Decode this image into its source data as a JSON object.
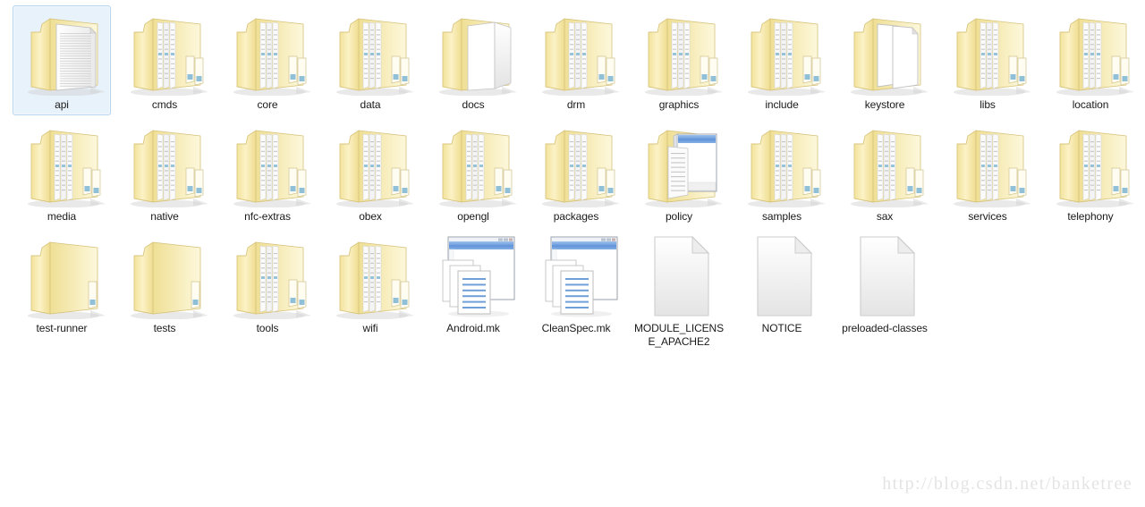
{
  "view": {
    "background": "#ffffff",
    "selection_fill": "#e8f2fb",
    "selection_border": "#b8d6ef",
    "folder_color": "#f7e9a8",
    "folder_color_light": "#fdf6d2",
    "folder_shadow": "#d9d9d9"
  },
  "watermark": {
    "text": "http://blog.csdn.net/banketree",
    "color": "#e4e4e4"
  },
  "items": [
    {
      "label": "api",
      "icon": "folder-open-doc-icon",
      "selected": true,
      "col": 0,
      "row": 0
    },
    {
      "label": "cmds",
      "icon": "folder-stack-icon",
      "selected": false,
      "col": 1,
      "row": 0
    },
    {
      "label": "core",
      "icon": "folder-stack-icon",
      "selected": false,
      "col": 2,
      "row": 0
    },
    {
      "label": "data",
      "icon": "folder-stack-icon",
      "selected": false,
      "col": 3,
      "row": 0
    },
    {
      "label": "docs",
      "icon": "folder-pages-icon",
      "selected": false,
      "col": 4,
      "row": 0
    },
    {
      "label": "drm",
      "icon": "folder-stack-icon",
      "selected": false,
      "col": 5,
      "row": 0
    },
    {
      "label": "graphics",
      "icon": "folder-stack-icon",
      "selected": false,
      "col": 6,
      "row": 0
    },
    {
      "label": "include",
      "icon": "folder-stack-icon",
      "selected": false,
      "col": 7,
      "row": 0
    },
    {
      "label": "keystore",
      "icon": "folder-twodocs-icon",
      "selected": false,
      "col": 8,
      "row": 0
    },
    {
      "label": "libs",
      "icon": "folder-stack-icon",
      "selected": false,
      "col": 9,
      "row": 0
    },
    {
      "label": "location",
      "icon": "folder-stack-icon",
      "selected": false,
      "col": 10,
      "row": 0
    },
    {
      "label": "media",
      "icon": "folder-stack-icon",
      "selected": false,
      "col": 0,
      "row": 1
    },
    {
      "label": "native",
      "icon": "folder-stack-icon",
      "selected": false,
      "col": 1,
      "row": 1
    },
    {
      "label": "nfc-extras",
      "icon": "folder-stack-icon",
      "selected": false,
      "col": 2,
      "row": 1
    },
    {
      "label": "obex",
      "icon": "folder-stack-icon",
      "selected": false,
      "col": 3,
      "row": 1
    },
    {
      "label": "opengl",
      "icon": "folder-stack-icon",
      "selected": false,
      "col": 4,
      "row": 1
    },
    {
      "label": "packages",
      "icon": "folder-stack-icon",
      "selected": false,
      "col": 5,
      "row": 1
    },
    {
      "label": "policy",
      "icon": "folder-window-icon",
      "selected": false,
      "col": 6,
      "row": 1
    },
    {
      "label": "samples",
      "icon": "folder-stack-icon",
      "selected": false,
      "col": 7,
      "row": 1
    },
    {
      "label": "sax",
      "icon": "folder-stack-icon",
      "selected": false,
      "col": 8,
      "row": 1
    },
    {
      "label": "services",
      "icon": "folder-stack-icon",
      "selected": false,
      "col": 9,
      "row": 1
    },
    {
      "label": "telephony",
      "icon": "folder-stack-icon",
      "selected": false,
      "col": 10,
      "row": 1
    },
    {
      "label": "test-runner",
      "icon": "folder-plain-icon",
      "selected": false,
      "col": 0,
      "row": 2
    },
    {
      "label": "tests",
      "icon": "folder-plain-icon",
      "selected": false,
      "col": 1,
      "row": 2
    },
    {
      "label": "tools",
      "icon": "folder-stack-icon",
      "selected": false,
      "col": 2,
      "row": 2
    },
    {
      "label": "wifi",
      "icon": "folder-stack-icon",
      "selected": false,
      "col": 3,
      "row": 2
    },
    {
      "label": "Android.mk",
      "icon": "file-makefile-icon",
      "selected": false,
      "col": 4,
      "row": 2
    },
    {
      "label": "CleanSpec.mk",
      "icon": "file-makefile-icon",
      "selected": false,
      "col": 5,
      "row": 2
    },
    {
      "label": "MODULE_LICENSE_APACHE2",
      "icon": "file-blank-icon",
      "selected": false,
      "col": 6,
      "row": 2
    },
    {
      "label": "NOTICE",
      "icon": "file-blank-icon",
      "selected": false,
      "col": 7,
      "row": 2
    },
    {
      "label": "preloaded-classes",
      "icon": "file-blank-icon",
      "selected": false,
      "col": 8,
      "row": 2
    }
  ]
}
